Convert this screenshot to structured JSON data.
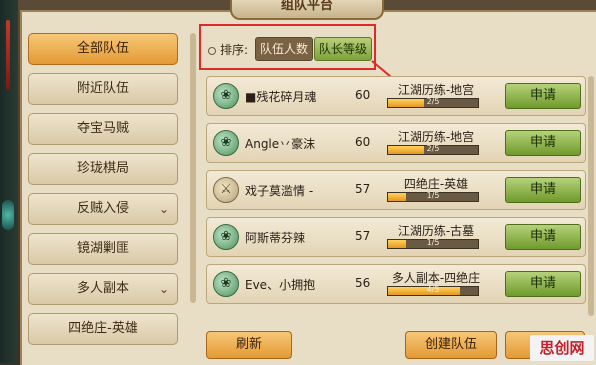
{
  "window": {
    "title": "组队平台"
  },
  "sidebar": {
    "items": [
      {
        "label": "全部队伍",
        "active": true,
        "has_chevron": false
      },
      {
        "label": "附近队伍",
        "active": false,
        "has_chevron": false
      },
      {
        "label": "夺宝马贼",
        "active": false,
        "has_chevron": false
      },
      {
        "label": "珍珑棋局",
        "active": false,
        "has_chevron": false
      },
      {
        "label": "反贼入侵",
        "active": false,
        "has_chevron": true
      },
      {
        "label": "镜湖剿匪",
        "active": false,
        "has_chevron": false
      },
      {
        "label": "多人副本",
        "active": false,
        "has_chevron": true
      },
      {
        "label": "四绝庄-英雄",
        "active": false,
        "has_chevron": false
      }
    ],
    "chevron_glyph": "⌄"
  },
  "sort": {
    "label": "排序:",
    "options": [
      "队伍人数",
      "队长等级"
    ],
    "selected": "队长等级"
  },
  "teams": [
    {
      "name": "■残花碎月魂",
      "level": "60",
      "activity": "江湖历练-地宫",
      "progress_text": "2/5",
      "progress": 0.4,
      "icon": "leaf-emblem-icon",
      "apply_label": "申请"
    },
    {
      "name": "Angle丷豪沫",
      "level": "60",
      "activity": "江湖历练-地宫",
      "progress_text": "2/5",
      "progress": 0.4,
      "icon": "leaf-emblem-icon",
      "apply_label": "申请"
    },
    {
      "name": "戏子莫滥情 -",
      "level": "57",
      "activity": "四绝庄-英雄",
      "progress_text": "1/5",
      "progress": 0.2,
      "icon": "sword-emblem-icon",
      "apply_label": "申请"
    },
    {
      "name": "阿斯蒂芬辣",
      "level": "57",
      "activity": "江湖历练-古墓",
      "progress_text": "1/5",
      "progress": 0.2,
      "icon": "leaf-emblem-icon",
      "apply_label": "申请"
    },
    {
      "name": "Eve、小拥抱",
      "level": "56",
      "activity": "多人副本-四绝庄",
      "progress_text": "4/5",
      "progress": 0.8,
      "icon": "leaf-emblem-icon",
      "apply_label": "申请"
    }
  ],
  "footer": {
    "refresh_label": "刷新",
    "create_label": "创建队伍"
  },
  "watermark": "思创网",
  "colors": {
    "accent_orange": "#e49a34",
    "apply_green": "#6f9a2c",
    "highlight_red": "#e02a2a"
  }
}
